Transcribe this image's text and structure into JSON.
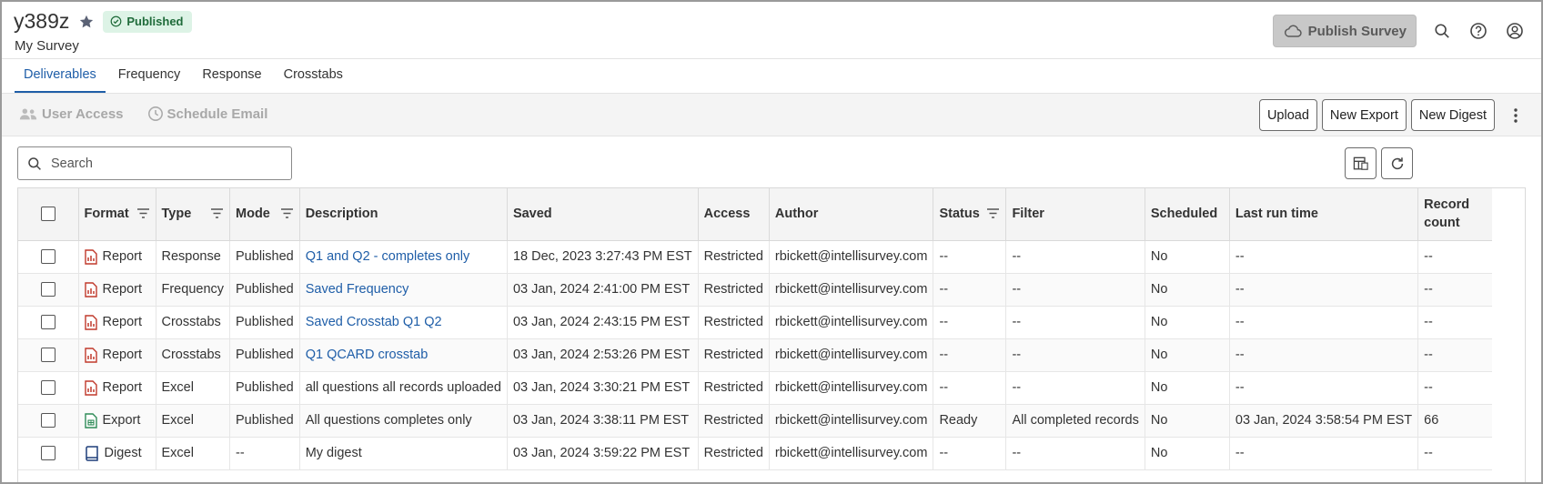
{
  "header": {
    "survey_id": "y389z",
    "status_badge": "Published",
    "subtitle": "My Survey",
    "publish_button": "Publish Survey"
  },
  "tabs": [
    {
      "label": "Deliverables",
      "active": true
    },
    {
      "label": "Frequency",
      "active": false
    },
    {
      "label": "Response",
      "active": false
    },
    {
      "label": "Crosstabs",
      "active": false
    }
  ],
  "toolbar": {
    "user_access": "User Access",
    "schedule_email": "Schedule Email",
    "upload": "Upload",
    "new_export": "New Export",
    "new_digest": "New Digest"
  },
  "search": {
    "placeholder": "Search"
  },
  "table": {
    "columns": [
      "Format",
      "Type",
      "Mode",
      "Description",
      "Saved",
      "Access",
      "Author",
      "Status",
      "Filter",
      "Scheduled",
      "Last run time",
      "Record count"
    ],
    "rows": [
      {
        "format": "Report",
        "format_icon": "report-pdf-icon",
        "type": "Response",
        "mode": "Published",
        "description": "Q1 and Q2 - completes only",
        "description_link": true,
        "saved": "18 Dec, 2023 3:27:43 PM EST",
        "access": "Restricted",
        "author": "rbickett@intellisurvey.com",
        "status": "--",
        "filter": "--",
        "scheduled": "No",
        "last_run": "--",
        "record_count": "--"
      },
      {
        "format": "Report",
        "format_icon": "report-pdf-icon",
        "type": "Frequency",
        "mode": "Published",
        "description": "Saved Frequency",
        "description_link": true,
        "saved": "03 Jan, 2024 2:41:00 PM EST",
        "access": "Restricted",
        "author": "rbickett@intellisurvey.com",
        "status": "--",
        "filter": "--",
        "scheduled": "No",
        "last_run": "--",
        "record_count": "--"
      },
      {
        "format": "Report",
        "format_icon": "report-pdf-icon",
        "type": "Crosstabs",
        "mode": "Published",
        "description": "Saved Crosstab Q1 Q2",
        "description_link": true,
        "saved": "03 Jan, 2024 2:43:15 PM EST",
        "access": "Restricted",
        "author": "rbickett@intellisurvey.com",
        "status": "--",
        "filter": "--",
        "scheduled": "No",
        "last_run": "--",
        "record_count": "--"
      },
      {
        "format": "Report",
        "format_icon": "report-pdf-icon",
        "type": "Crosstabs",
        "mode": "Published",
        "description": "Q1 QCARD crosstab",
        "description_link": true,
        "saved": "03 Jan, 2024 2:53:26 PM EST",
        "access": "Restricted",
        "author": "rbickett@intellisurvey.com",
        "status": "--",
        "filter": "--",
        "scheduled": "No",
        "last_run": "--",
        "record_count": "--"
      },
      {
        "format": "Report",
        "format_icon": "report-pdf-icon",
        "type": "Excel",
        "mode": "Published",
        "description": "all questions all records uploaded",
        "description_link": false,
        "saved": "03 Jan, 2024 3:30:21 PM EST",
        "access": "Restricted",
        "author": "rbickett@intellisurvey.com",
        "status": "--",
        "filter": "--",
        "scheduled": "No",
        "last_run": "--",
        "record_count": "--"
      },
      {
        "format": "Export",
        "format_icon": "export-sheet-icon",
        "type": "Excel",
        "mode": "Published",
        "description": "All questions completes only",
        "description_link": false,
        "saved": "03 Jan, 2024 3:38:11 PM EST",
        "access": "Restricted",
        "author": "rbickett@intellisurvey.com",
        "status": "Ready",
        "filter": "All completed records",
        "scheduled": "No",
        "last_run": "03 Jan, 2024 3:58:54 PM EST",
        "record_count": "66"
      },
      {
        "format": "Digest",
        "format_icon": "digest-book-icon",
        "type": "Excel",
        "mode": "--",
        "description": "My digest",
        "description_link": false,
        "saved": "03 Jan, 2024 3:59:22 PM EST",
        "access": "Restricted",
        "author": "rbickett@intellisurvey.com",
        "status": "--",
        "filter": "--",
        "scheduled": "No",
        "last_run": "--",
        "record_count": "--"
      }
    ]
  },
  "colors": {
    "link": "#1f5ea8",
    "badge_bg": "#ddf3e6",
    "badge_fg": "#1f6b3a",
    "report_icon": "#c0392b",
    "export_icon": "#2e8b57",
    "digest_icon": "#1f3f7a"
  }
}
